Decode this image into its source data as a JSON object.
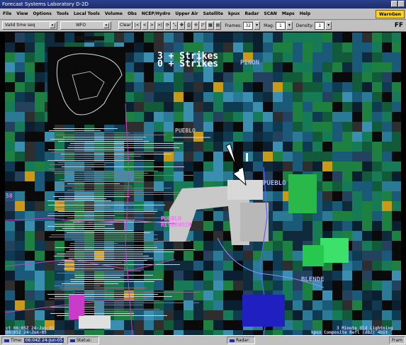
{
  "window": {
    "title": "Forecast Systems Laboratory D-2D"
  },
  "menu": {
    "items": [
      "File",
      "View",
      "Options",
      "Tools",
      "Local Tools",
      "Volume",
      "Obs",
      "NCEP/Hydro",
      "Upper Air",
      "Satellite",
      "kpux",
      "Radar",
      "SCAN",
      "Maps",
      "Help"
    ],
    "warning_label": "WarnGen"
  },
  "toolbar": {
    "time_select": "Valid time seq",
    "site_select": "WFO",
    "clear_label": "Clear",
    "frame_buttons": [
      "|<",
      "<",
      ">",
      ">|"
    ],
    "frames_label": "Frames:",
    "frames_value": "32",
    "mag_label": "Mag:",
    "mag_value": "1",
    "density_label": "Density:",
    "density_value": "1",
    "right_label": "FF",
    "swatch_colors": [
      "#ff0000",
      "#00c000",
      "#0000ff",
      "#ff00ff",
      "#ffff00",
      "#00ffff",
      "#ffffff"
    ]
  },
  "map": {
    "strikes_line1": "3 + Strikes",
    "strikes_line2": "0 + Strikes",
    "places": {
      "pinon": "PINON",
      "pueblo_top": "PUEBLO",
      "pueblo": "PUEBLO",
      "pueblo_reservoir_1": "PUEBLO",
      "pueblo_reservoir_2": "RESERVOIR",
      "blende": "BLENDE"
    },
    "left_marker": "58",
    "bottom_right_line1": "3 Minute Old Lightning",
    "bottom_right_line2": "kpux Composite Refl (dBZ) 4bit",
    "bottom_left_line1": "ct 06:05Z 24-Jun-05",
    "bottom_left_line2": "00:05Z 24-Jun-05"
  },
  "statusbar": {
    "time_label": "Time:",
    "time_value": "06:04Z 24-Jun-05",
    "status_label": "Status:",
    "radar_label": "Radar:",
    "right_label": "Fram"
  }
}
